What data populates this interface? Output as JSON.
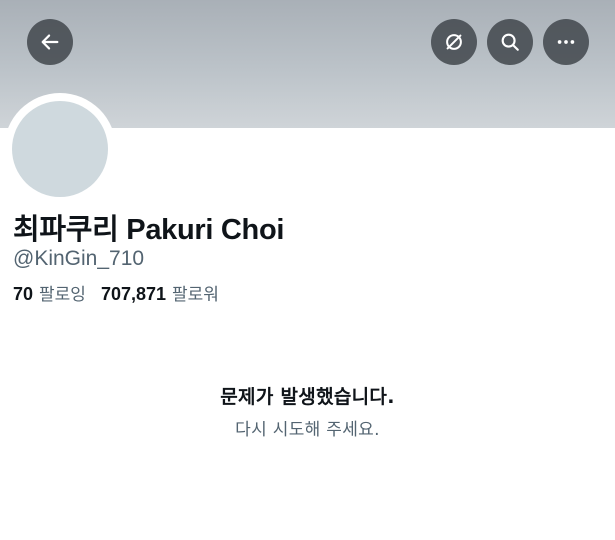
{
  "header": {
    "back_icon": "arrow-left-icon",
    "translate_icon": "translate-off-icon",
    "search_icon": "search-icon",
    "more_icon": "more-horizontal-icon"
  },
  "profile": {
    "display_name": "최파쿠리 Pakuri Choi",
    "handle": "@KinGin_710",
    "following_count": "70",
    "following_label": "팔로잉",
    "followers_count": "707,871",
    "followers_label": "팔로워"
  },
  "error": {
    "title": "문제가 발생했습니다.",
    "subtitle": "다시 시도해 주세요."
  },
  "colors": {
    "primary_text": "#0f1419",
    "secondary_text": "#536471",
    "avatar_placeholder": "#cfd9de",
    "header_button_bg": "#444a50"
  }
}
